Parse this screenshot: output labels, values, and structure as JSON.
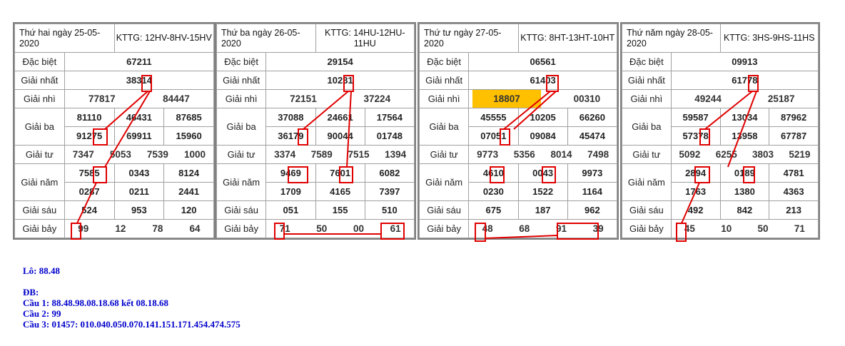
{
  "boards": [
    {
      "header_day": "Thứ hai ngày 25-05-2020",
      "header_kttg": "KTTG: 12HV-8HV-15HV",
      "labels": [
        "Đặc biệt",
        "Giải nhất",
        "Giải nhì",
        "Giải ba",
        "Giải tư",
        "Giải năm",
        "Giải sáu",
        "Giải bảy"
      ],
      "db": "67211",
      "g1": "38314",
      "g2": [
        "77817",
        "84447"
      ],
      "g3": [
        "81110",
        "46431",
        "87685",
        "91275",
        "69911",
        "15960"
      ],
      "g4": [
        "7347",
        "5053",
        "7539",
        "1000"
      ],
      "g5": [
        "7585",
        "0343",
        "8124",
        "0287",
        "0211",
        "2441"
      ],
      "g6": [
        "524",
        "953",
        "120"
      ],
      "g7": [
        "99",
        "12",
        "78",
        "64"
      ]
    },
    {
      "header_day": "Thứ ba ngày 26-05-2020",
      "header_kttg": "KTTG: 14HU-12HU-11HU",
      "labels": [
        "Đặc biệt",
        "Giải nhất",
        "Giải nhì",
        "Giải ba",
        "Giải tư",
        "Giải năm",
        "Giải sáu",
        "Giải bảy"
      ],
      "db": "29154",
      "g1": "10231",
      "g2": [
        "72151",
        "37224"
      ],
      "g3": [
        "37088",
        "24661",
        "17564",
        "36179",
        "90044",
        "01748"
      ],
      "g4": [
        "3374",
        "7589",
        "7515",
        "1394"
      ],
      "g5": [
        "9469",
        "7601",
        "6082",
        "1709",
        "4165",
        "7397"
      ],
      "g6": [
        "051",
        "155",
        "510"
      ],
      "g7": [
        "71",
        "50",
        "00",
        "61"
      ]
    },
    {
      "header_day": "Thứ tư ngày 27-05-2020",
      "header_kttg": "KTTG: 8HT-13HT-10HT",
      "labels": [
        "Đặc biệt",
        "Giải nhất",
        "Giải nhì",
        "Giải ba",
        "Giải tư",
        "Giải năm",
        "Giải sáu",
        "Giải bảy"
      ],
      "db": "06561",
      "g1": "61403",
      "g2": [
        "18807",
        "00310"
      ],
      "g3": [
        "45555",
        "10205",
        "66260",
        "07051",
        "09084",
        "45474"
      ],
      "g4": [
        "9773",
        "5356",
        "8014",
        "7498"
      ],
      "g5": [
        "4610",
        "0043",
        "9973",
        "0230",
        "1522",
        "1164"
      ],
      "g6": [
        "675",
        "187",
        "962"
      ],
      "g7": [
        "48",
        "68",
        "91",
        "39"
      ]
    },
    {
      "header_day": "Thứ năm ngày 28-05-2020",
      "header_kttg": "KTTG: 3HS-9HS-11HS",
      "labels": [
        "Đặc biệt",
        "Giải nhất",
        "Giải nhì",
        "Giải ba",
        "Giải tư",
        "Giải năm",
        "Giải sáu",
        "Giải bảy"
      ],
      "db": "09913",
      "g1": "61778",
      "g2": [
        "49244",
        "25187"
      ],
      "g3": [
        "59587",
        "13034",
        "87962",
        "57378",
        "13958",
        "67787"
      ],
      "g4": [
        "5092",
        "6255",
        "3803",
        "5219"
      ],
      "g5": [
        "2894",
        "0189",
        "4781",
        "1763",
        "1380",
        "4363"
      ],
      "g6": [
        "492",
        "842",
        "213"
      ],
      "g7": [
        "45",
        "10",
        "50",
        "71"
      ]
    }
  ],
  "info": {
    "lo": "Lô: 88.48",
    "db": "ĐB:",
    "cau1": "Cầu 1: 88.48.98.08.18.68 kết 08.18.68",
    "cau2": "Cầu 2: 99",
    "cau3": "Cầu 3: 01457: 010.040.050.070.141.151.171.454.474.575"
  },
  "colors": {
    "special": "#e00000",
    "highlight": "#ffc000",
    "marker": "#e00000",
    "info_text": "#0000cc"
  }
}
